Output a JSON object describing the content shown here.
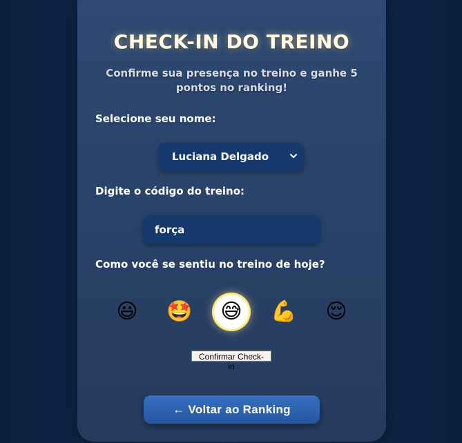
{
  "page": {
    "title": "CHECK-IN DO TREINO",
    "subtitle": "Confirme sua presença no treino e ganhe 5 pontos no ranking!"
  },
  "form": {
    "name_label": "Selecione seu nome:",
    "name_selected": "Luciana Delgado",
    "code_label": "Digite o código do treino:",
    "code_value": "força",
    "mood_label": "Como você se sentiu no treino de hoje?",
    "moods": [
      {
        "icon": "grinning-face-icon",
        "glyph": "😃",
        "selected": false
      },
      {
        "icon": "star-struck-face-icon",
        "glyph": "🤩",
        "selected": false
      },
      {
        "icon": "grinning-sweat-face-icon",
        "glyph": "😅",
        "selected": true
      },
      {
        "icon": "flexed-biceps-icon",
        "glyph": "💪",
        "selected": false
      },
      {
        "icon": "relieved-face-icon",
        "glyph": "😌",
        "selected": false
      }
    ],
    "confirm_label": "Confirmar Check-in"
  },
  "nav": {
    "back_label": "← Voltar ao Ranking"
  },
  "colors": {
    "background": "#0f2447",
    "card": "#2c466d",
    "field": "#173a6e",
    "button": "#2e66b4",
    "title_glow": "#ffe696"
  }
}
